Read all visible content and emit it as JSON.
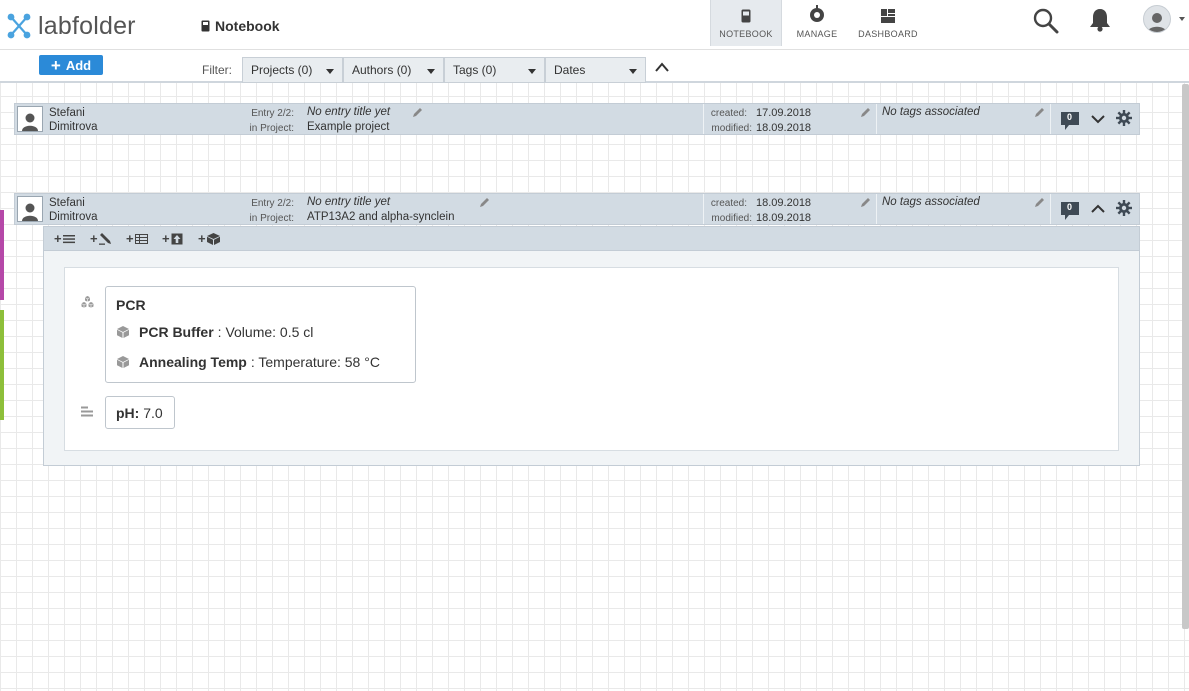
{
  "app": {
    "name": "labfolder"
  },
  "breadcrumb": {
    "label": "Notebook"
  },
  "nav": {
    "tabs": [
      {
        "label": "NOTEBOOK",
        "icon": "notebook-icon",
        "active": true
      },
      {
        "label": "MANAGE",
        "icon": "manage-icon",
        "active": false
      },
      {
        "label": "DASHBOARD",
        "icon": "dashboard-icon",
        "active": false
      }
    ]
  },
  "toolbar": {
    "add_label": "Add",
    "filter_label": "Filter:",
    "filters": [
      "Projects (0)",
      "Authors (0)",
      "Tags (0)",
      "Dates"
    ]
  },
  "entries": [
    {
      "author_first": "Stefani",
      "author_last": "Dimitrova",
      "entry_label": "Entry 2/2:",
      "title": "No entry title yet",
      "project_label": "in Project:",
      "project": "Example project",
      "created_label": "created:",
      "created": "17.09.2018",
      "modified_label": "modified:",
      "modified": "18.09.2018",
      "tags": "No tags associated",
      "comments": "0",
      "expanded": false
    },
    {
      "author_first": "Stefani",
      "author_last": "Dimitrova",
      "entry_label": "Entry 2/2:",
      "title": "No entry title yet",
      "project_label": "in Project:",
      "project": "ATP13A2 and alpha-synclein",
      "created_label": "created:",
      "created": "18.09.2018",
      "modified_label": "modified:",
      "modified": "18.09.2018",
      "tags": "No tags associated",
      "comments": "0",
      "expanded": true
    }
  ],
  "element_tools": [
    "add-text-icon",
    "add-sketch-icon",
    "add-table-icon",
    "add-upload-icon",
    "add-data-icon"
  ],
  "data_group": {
    "title": "PCR",
    "items": [
      {
        "name": "PCR Buffer",
        "value": ": Volume: 0.5 cl"
      },
      {
        "name": "Annealing Temp",
        "value": ": Temperature: 58 °C"
      }
    ]
  },
  "descriptive": {
    "name": "pH:",
    "value": "7.0"
  },
  "colors": {
    "accent": "#2b8ad8",
    "entry_header": "#d2dbe3",
    "side_mark_1": "#b548a8",
    "side_mark_2": "#8dbf3a"
  }
}
